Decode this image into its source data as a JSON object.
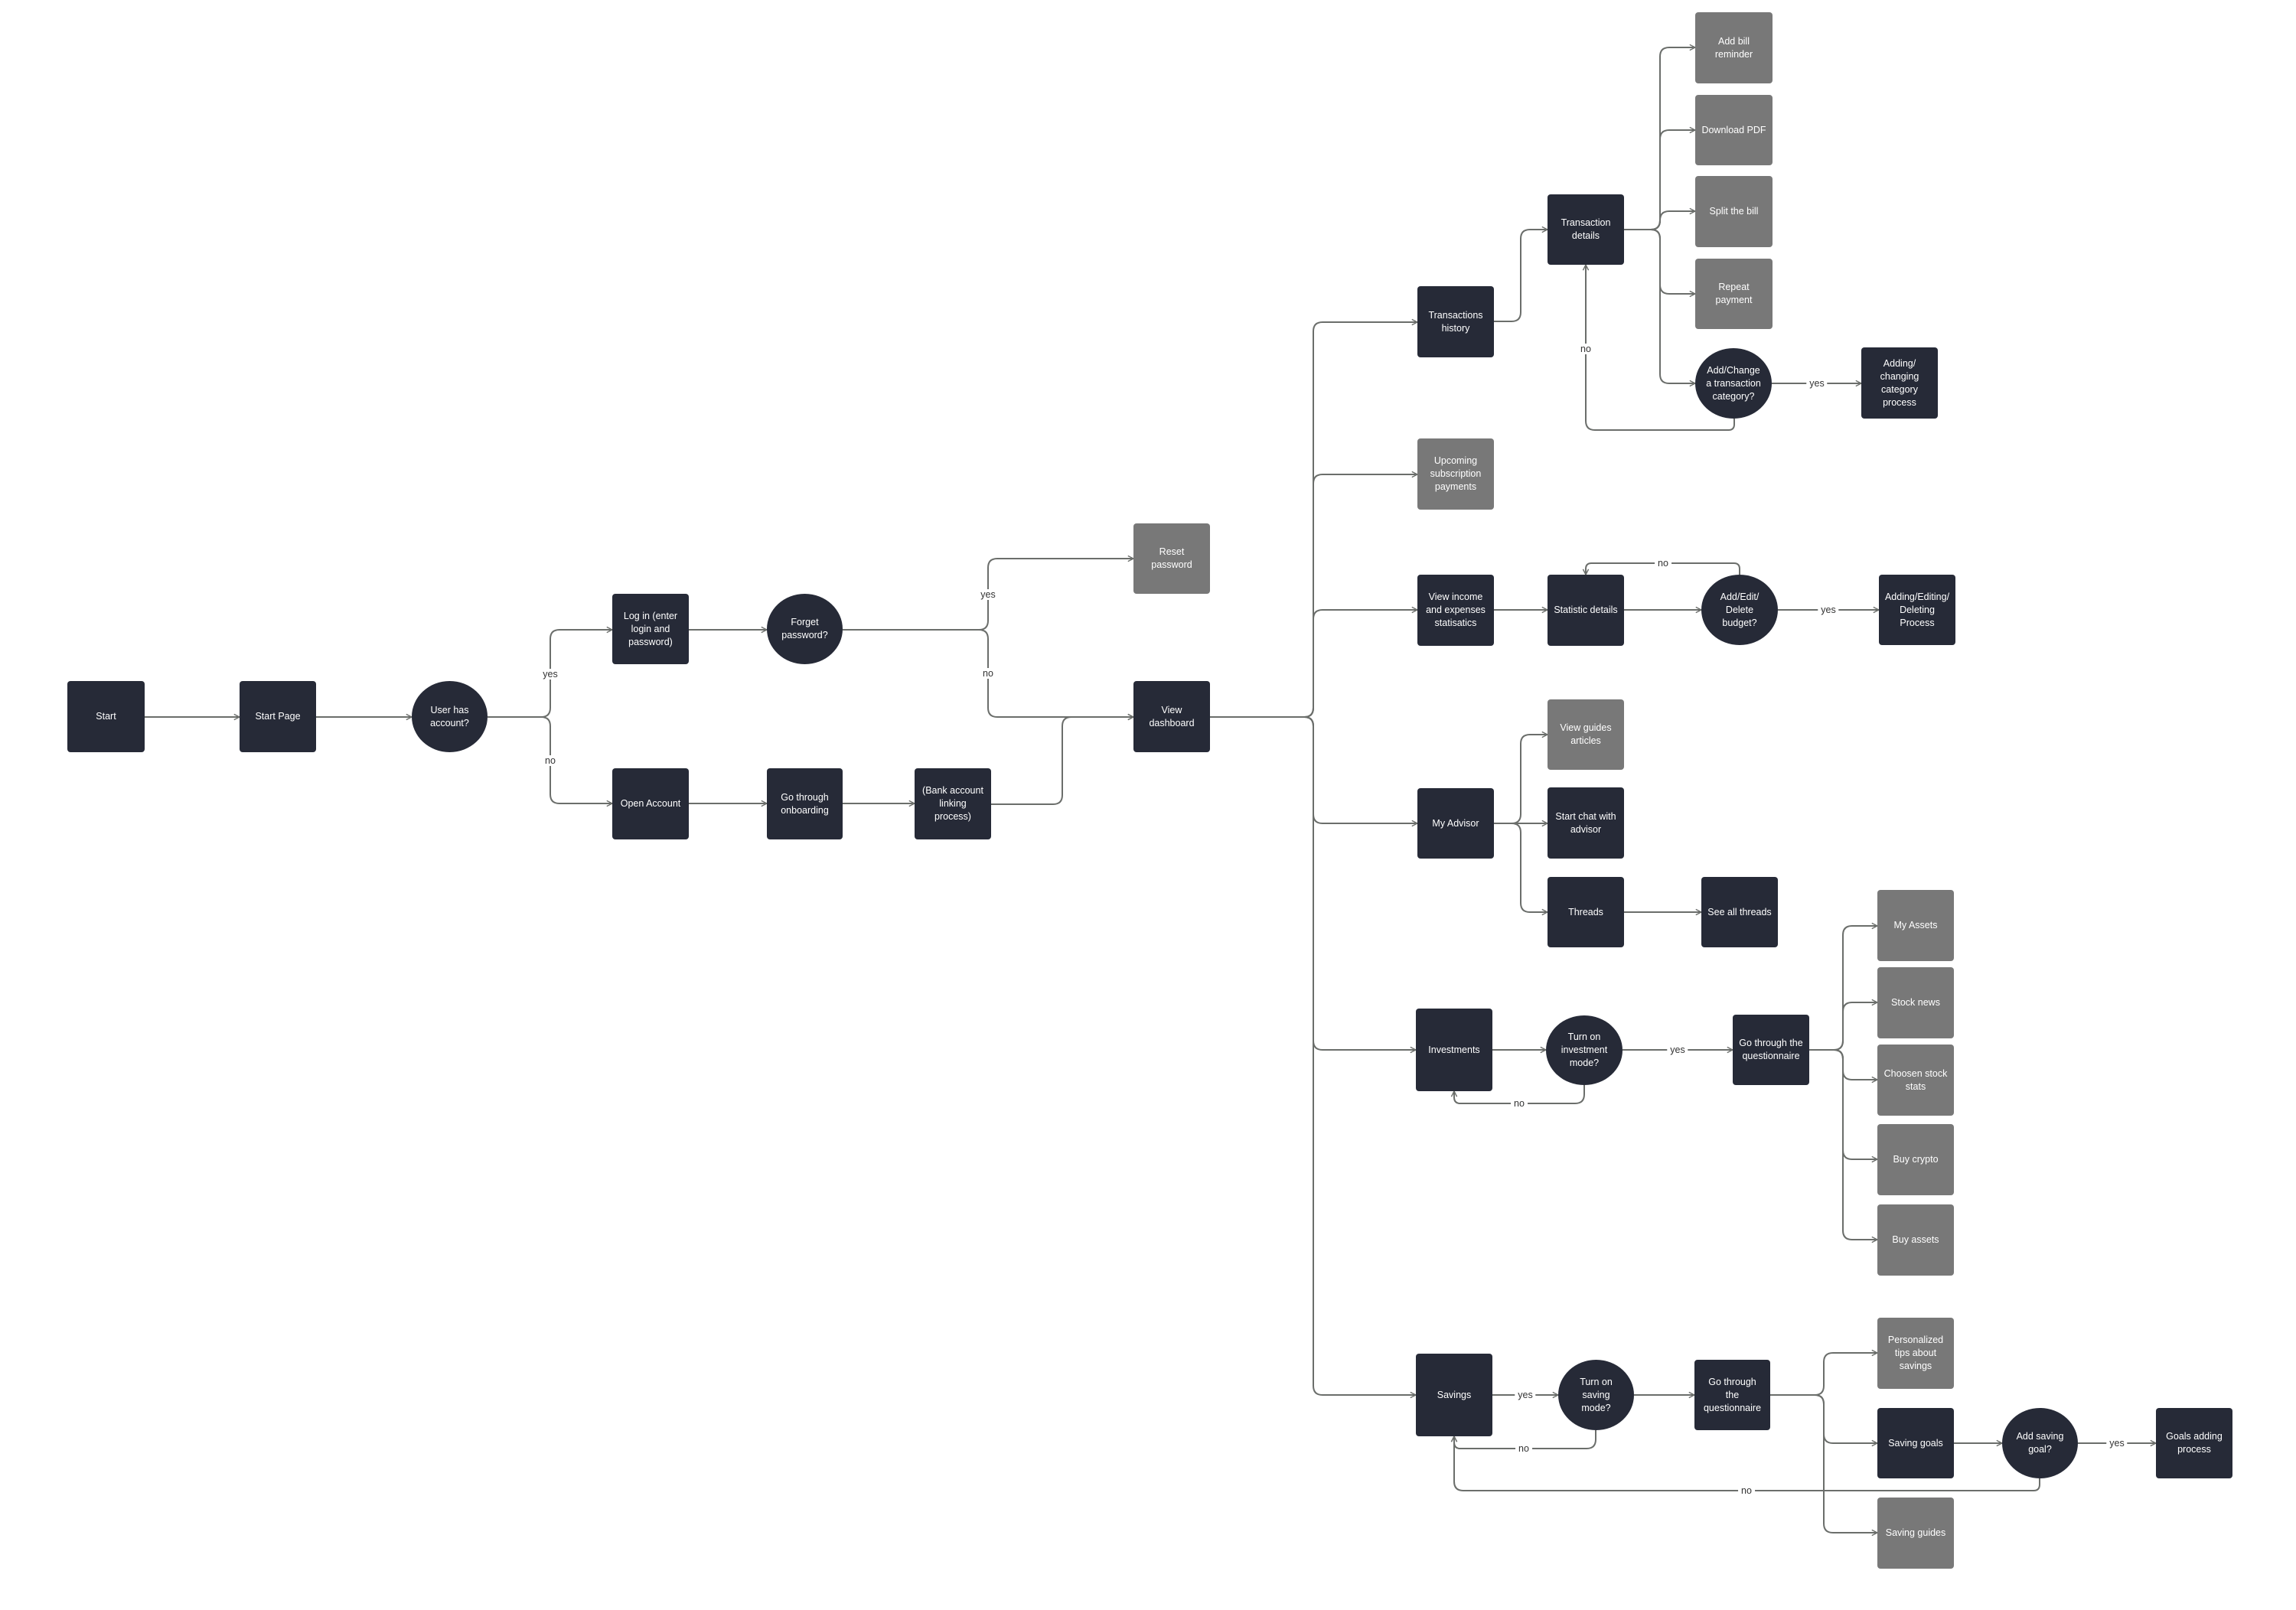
{
  "diagram": {
    "type": "user-flow",
    "colors": {
      "process": "#262a37",
      "secondary": "#787878",
      "decision": "#262a37",
      "connector": "#6b6e6b",
      "text_on_node": "#ffffff",
      "edge_label": "#333333",
      "background": "#ffffff"
    },
    "nodes": {
      "start": {
        "label": "Start",
        "kind": "process"
      },
      "start_page": {
        "label": "Start Page",
        "kind": "process"
      },
      "has_account": {
        "label": "User has\naccount?",
        "kind": "decision"
      },
      "login": {
        "label": "Log in (enter\nlogin and\npassword)",
        "kind": "process"
      },
      "forget_pw": {
        "label": "Forget\npassword?",
        "kind": "decision"
      },
      "reset_pw": {
        "label": "Reset\npassword",
        "kind": "secondary"
      },
      "open_account": {
        "label": "Open Account",
        "kind": "process"
      },
      "onboarding": {
        "label": "Go through\nonboarding",
        "kind": "process"
      },
      "bank_link": {
        "label": "(Bank account\nlinking process)",
        "kind": "process"
      },
      "dashboard": {
        "label": "View\ndashboard",
        "kind": "process"
      },
      "tx_history": {
        "label": "Transactions\nhistory",
        "kind": "process"
      },
      "tx_details": {
        "label": "Transaction\ndetails",
        "kind": "process"
      },
      "bill_reminder": {
        "label": "Add bill\nreminder",
        "kind": "secondary"
      },
      "download_pdf": {
        "label": "Download PDF",
        "kind": "secondary"
      },
      "split_bill": {
        "label": "Split the bill",
        "kind": "secondary"
      },
      "repeat_payment": {
        "label": "Repeat\npayment",
        "kind": "secondary"
      },
      "change_category": {
        "label": "Add/Change\na transaction\ncategory?",
        "kind": "decision"
      },
      "category_process": {
        "label": "Adding/\nchanging\ncategory\nprocess",
        "kind": "process"
      },
      "upcoming_subs": {
        "label": "Upcoming\nsubscription\npayments",
        "kind": "secondary"
      },
      "income_stats": {
        "label": "View income\nand expenses\nstatisatics",
        "kind": "process"
      },
      "stat_details": {
        "label": "Statistic details",
        "kind": "process"
      },
      "budget_q": {
        "label": "Add/Edit/\nDelete\nbudget?",
        "kind": "decision"
      },
      "budget_process": {
        "label": "Adding/Editing/\nDeleting\nProcess",
        "kind": "process"
      },
      "advisor": {
        "label": "My Advisor",
        "kind": "process"
      },
      "guides_articles": {
        "label": "View guides\narticles",
        "kind": "secondary"
      },
      "chat_advisor": {
        "label": "Start chat with\nadvisor",
        "kind": "process"
      },
      "threads": {
        "label": "Threads",
        "kind": "process"
      },
      "all_threads": {
        "label": "See all threads",
        "kind": "process"
      },
      "investments": {
        "label": "Investments",
        "kind": "process"
      },
      "invest_mode_q": {
        "label": "Turn on\ninvestment\nmode?",
        "kind": "decision"
      },
      "invest_questionnaire": {
        "label": "Go through the\nquestionnaire",
        "kind": "process"
      },
      "my_assets": {
        "label": "My Assets",
        "kind": "secondary"
      },
      "stock_news": {
        "label": "Stock news",
        "kind": "secondary"
      },
      "stock_stats": {
        "label": "Choosen stock\nstats",
        "kind": "secondary"
      },
      "buy_crypto": {
        "label": "Buy crypto",
        "kind": "secondary"
      },
      "buy_assets": {
        "label": "Buy assets",
        "kind": "secondary"
      },
      "savings": {
        "label": "Savings",
        "kind": "process"
      },
      "saving_mode_q": {
        "label": "Turn on\nsaving\nmode?",
        "kind": "decision"
      },
      "saving_questionnaire": {
        "label": "Go through the\nquestionnaire",
        "kind": "process"
      },
      "saving_tips": {
        "label": "Personalized\ntips about\nsavings",
        "kind": "secondary"
      },
      "saving_goals": {
        "label": "Saving goals",
        "kind": "process"
      },
      "add_goal_q": {
        "label": "Add saving\ngoal?",
        "kind": "decision"
      },
      "goals_process": {
        "label": "Goals adding\nprocess",
        "kind": "process"
      },
      "saving_guides": {
        "label": "Saving guides",
        "kind": "secondary"
      }
    },
    "edges": [
      {
        "from": "start",
        "to": "start_page",
        "label": ""
      },
      {
        "from": "start_page",
        "to": "has_account",
        "label": ""
      },
      {
        "from": "has_account",
        "to": "login",
        "label": "yes"
      },
      {
        "from": "has_account",
        "to": "open_account",
        "label": "no"
      },
      {
        "from": "login",
        "to": "forget_pw",
        "label": ""
      },
      {
        "from": "forget_pw",
        "to": "reset_pw",
        "label": "yes"
      },
      {
        "from": "forget_pw",
        "to": "dashboard",
        "label": "no"
      },
      {
        "from": "open_account",
        "to": "onboarding",
        "label": ""
      },
      {
        "from": "onboarding",
        "to": "bank_link",
        "label": ""
      },
      {
        "from": "bank_link",
        "to": "dashboard",
        "label": ""
      },
      {
        "from": "dashboard",
        "to": "tx_history",
        "label": ""
      },
      {
        "from": "dashboard",
        "to": "upcoming_subs",
        "label": ""
      },
      {
        "from": "dashboard",
        "to": "income_stats",
        "label": ""
      },
      {
        "from": "dashboard",
        "to": "advisor",
        "label": ""
      },
      {
        "from": "dashboard",
        "to": "investments",
        "label": ""
      },
      {
        "from": "dashboard",
        "to": "savings",
        "label": ""
      },
      {
        "from": "tx_history",
        "to": "tx_details",
        "label": ""
      },
      {
        "from": "tx_details",
        "to": "bill_reminder",
        "label": ""
      },
      {
        "from": "tx_details",
        "to": "download_pdf",
        "label": ""
      },
      {
        "from": "tx_details",
        "to": "split_bill",
        "label": ""
      },
      {
        "from": "tx_details",
        "to": "repeat_payment",
        "label": ""
      },
      {
        "from": "tx_details",
        "to": "change_category",
        "label": ""
      },
      {
        "from": "change_category",
        "to": "category_process",
        "label": "yes"
      },
      {
        "from": "change_category",
        "to": "tx_details",
        "label": "no"
      },
      {
        "from": "income_stats",
        "to": "stat_details",
        "label": ""
      },
      {
        "from": "stat_details",
        "to": "budget_q",
        "label": ""
      },
      {
        "from": "budget_q",
        "to": "budget_process",
        "label": "yes"
      },
      {
        "from": "budget_q",
        "to": "stat_details",
        "label": "no"
      },
      {
        "from": "advisor",
        "to": "guides_articles",
        "label": ""
      },
      {
        "from": "advisor",
        "to": "chat_advisor",
        "label": ""
      },
      {
        "from": "advisor",
        "to": "threads",
        "label": ""
      },
      {
        "from": "threads",
        "to": "all_threads",
        "label": ""
      },
      {
        "from": "investments",
        "to": "invest_mode_q",
        "label": ""
      },
      {
        "from": "invest_mode_q",
        "to": "invest_questionnaire",
        "label": "yes"
      },
      {
        "from": "invest_mode_q",
        "to": "investments",
        "label": "no"
      },
      {
        "from": "invest_questionnaire",
        "to": "my_assets",
        "label": ""
      },
      {
        "from": "invest_questionnaire",
        "to": "stock_news",
        "label": ""
      },
      {
        "from": "invest_questionnaire",
        "to": "stock_stats",
        "label": ""
      },
      {
        "from": "invest_questionnaire",
        "to": "buy_crypto",
        "label": ""
      },
      {
        "from": "invest_questionnaire",
        "to": "buy_assets",
        "label": ""
      },
      {
        "from": "savings",
        "to": "saving_mode_q",
        "label": "yes"
      },
      {
        "from": "saving_mode_q",
        "to": "savings",
        "label": "no"
      },
      {
        "from": "saving_mode_q",
        "to": "saving_questionnaire",
        "label": ""
      },
      {
        "from": "saving_questionnaire",
        "to": "saving_tips",
        "label": ""
      },
      {
        "from": "saving_questionnaire",
        "to": "saving_goals",
        "label": ""
      },
      {
        "from": "saving_questionnaire",
        "to": "saving_guides",
        "label": ""
      },
      {
        "from": "saving_goals",
        "to": "add_goal_q",
        "label": ""
      },
      {
        "from": "add_goal_q",
        "to": "goals_process",
        "label": "yes"
      },
      {
        "from": "add_goal_q",
        "to": "savings",
        "label": "no"
      }
    ]
  }
}
